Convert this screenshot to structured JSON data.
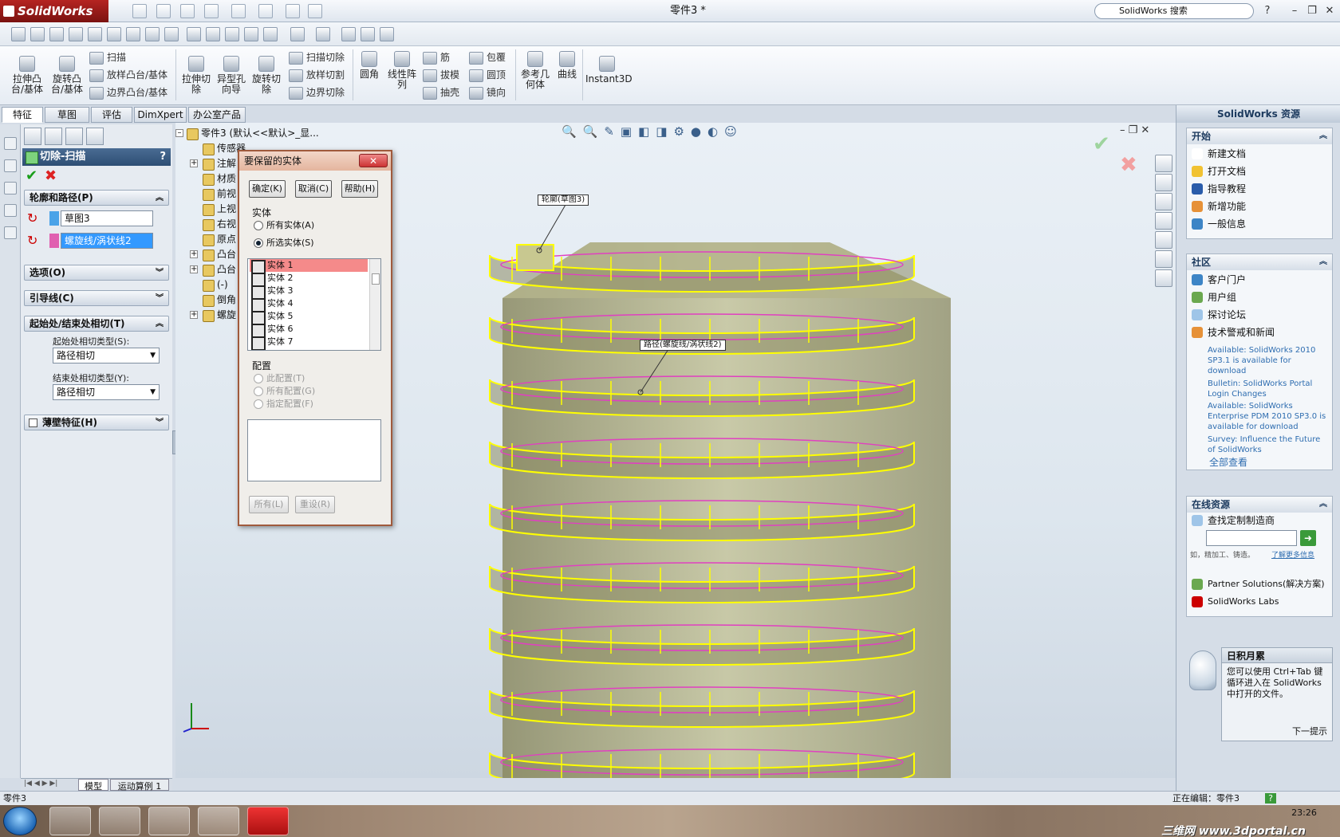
{
  "app": {
    "name": "SolidWorks",
    "doc_title": "零件3 *",
    "search_placeholder": "SolidWorks 搜索"
  },
  "window_controls": {
    "help": "?",
    "min": "–",
    "restore": "❐",
    "close": "✕"
  },
  "ribbon": {
    "extrude_boss": "拉伸凸\n台/基体",
    "revolve_boss": "旋转凸\n台/基体",
    "sweep": "扫描",
    "loft_boss": "放样凸台/基体",
    "boundary_boss": "边界凸台/基体",
    "extrude_cut": "拉伸切\n除",
    "hole_wizard": "异型孔\n向导",
    "revolve_cut": "旋转切\n除",
    "sweep_cut": "扫描切除",
    "loft_cut": "放样切割",
    "boundary_cut": "边界切除",
    "fillet": "圆角",
    "linear_pattern": "线性阵\n列",
    "rib": "筋",
    "draft": "拔模",
    "shell": "抽壳",
    "wrap": "包覆",
    "dome": "圆顶",
    "mirror": "镜向",
    "ref_geometry": "参考几\n何体",
    "curves": "曲线",
    "instant3d": "Instant3D"
  },
  "tabs": [
    "特征",
    "草图",
    "评估",
    "DimXpert",
    "办公室产品"
  ],
  "property_manager": {
    "title": "切除-扫描",
    "help": "?",
    "profile_path_group": "轮廓和路径(P)",
    "profile_value": "草图3",
    "path_value": "螺旋线/涡状线2",
    "options_group": "选项(O)",
    "guide_group": "引导线(C)",
    "tangency_group": "起始处/结束处相切(T)",
    "start_label": "起始处相切类型(S):",
    "start_value": "路径相切",
    "end_label": "结束处相切类型(Y):",
    "end_value": "路径相切",
    "thin_group": "薄壁特征(H)",
    "bottom_tabs": [
      "模型",
      "运动算例 1"
    ]
  },
  "feature_tree": {
    "root": "零件3 (默认<<默认>_显...",
    "items": [
      "传感器",
      "注解",
      "材质",
      "前视",
      "上视",
      "右视",
      "原点",
      "凸台",
      "凸台",
      "(-)",
      "倒角",
      "螺旋"
    ]
  },
  "dialog": {
    "title": "要保留的实体",
    "close": "✕",
    "ok": "确定(K)",
    "cancel": "取消(C)",
    "help": "帮助(H)",
    "bodies_label": "实体",
    "all_bodies": "所有实体(A)",
    "selected_bodies": "所选实体(S)",
    "bodies": [
      "实体 1",
      "实体 2",
      "实体 3",
      "实体 4",
      "实体 5",
      "实体 6",
      "实体 7"
    ],
    "selected_index": 0,
    "config_label": "配置",
    "this_config": "此配置(T)",
    "all_configs": "所有配置(G)",
    "specified_configs": "指定配置(F)",
    "all_btn": "所有(L)",
    "reset_btn": "重设(R)"
  },
  "callouts": {
    "profile": "轮廓(草图3)",
    "path": "路径(螺旋线/涡状线2)"
  },
  "resources": {
    "title": "SolidWorks 资源",
    "start_head": "开始",
    "start_items": [
      "新建文档",
      "打开文档",
      "指导教程",
      "新增功能",
      "一般信息"
    ],
    "community_head": "社区",
    "community_items": [
      "客户门户",
      "用户组",
      "探讨论坛",
      "技术警戒和新闻"
    ],
    "news": [
      "Available: SolidWorks 2010 SP3.1 is available for download",
      "Bulletin: SolidWorks Portal Login Changes",
      "Available: SolidWorks Enterprise PDM 2010 SP3.0 is available for download",
      "Survey: Influence the Future of SolidWorks"
    ],
    "view_all": "全部查看",
    "online_head": "在线资源",
    "find_mfr": "查找定制制造商",
    "find_hint": "如，精加工、铸造。",
    "find_more": "了解更多信息",
    "partner": "Partner Solutions(解决方案)",
    "labs": "SolidWorks Labs",
    "tip_title": "日积月累",
    "tip_text": "您可以使用 Ctrl+Tab 键循环进入在 SolidWorks 中打开的文件。",
    "tip_next": "下一提示"
  },
  "status": {
    "left": "零件3",
    "right": "正在编辑：零件3",
    "help": "?"
  },
  "taskbar": {
    "time": "23:26",
    "watermark": "三维网 www.3dportal.cn"
  },
  "colors": {
    "accent": "#3399ff",
    "header": "#2d4e74",
    "selected_body": "#f58a8a",
    "helix": "#ffff00",
    "path": "#e040c0"
  }
}
